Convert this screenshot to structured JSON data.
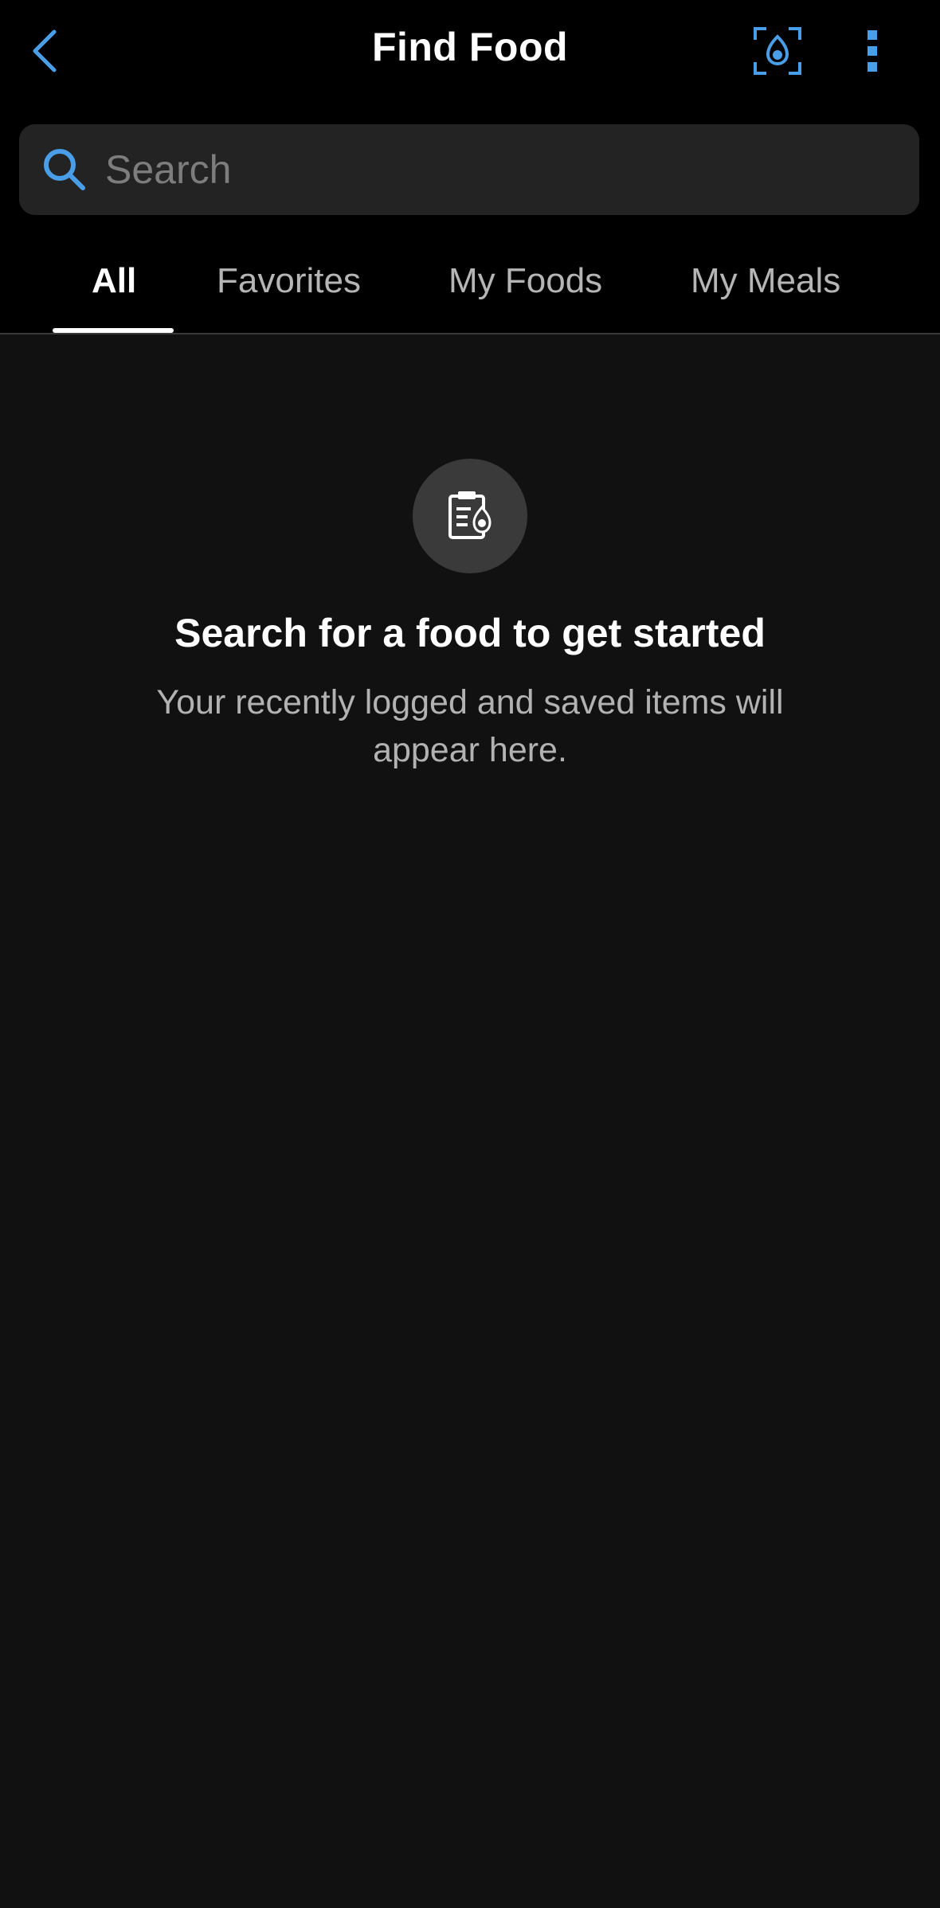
{
  "header": {
    "title": "Find Food",
    "back_icon": "chevron-left-icon",
    "scan_icon": "food-scan-icon",
    "more_icon": "more-vertical-icon",
    "accent_color": "#4a9ee8"
  },
  "search": {
    "placeholder": "Search",
    "value": "",
    "icon": "search-icon"
  },
  "tabs": [
    {
      "label": "All",
      "active": true
    },
    {
      "label": "Favorites",
      "active": false
    },
    {
      "label": "My Foods",
      "active": false
    },
    {
      "label": "My Meals",
      "active": false
    }
  ],
  "empty_state": {
    "icon": "clipboard-food-icon",
    "title": "Search for a food to get started",
    "description": "Your recently logged and saved items will appear here."
  }
}
